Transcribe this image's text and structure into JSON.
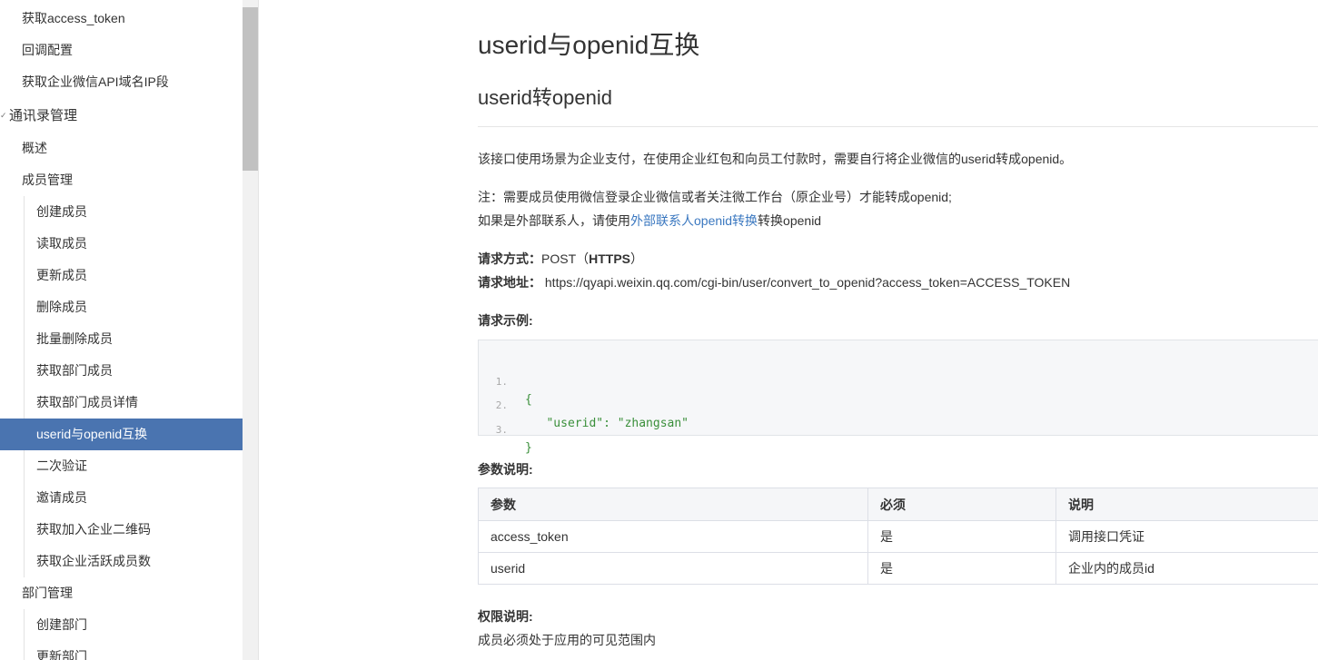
{
  "sidebar": {
    "items": [
      {
        "label": "获取access_token",
        "level": 1
      },
      {
        "label": "回调配置",
        "level": 1
      },
      {
        "label": "获取企业微信API域名IP段",
        "level": 1
      },
      {
        "label": "通讯录管理",
        "level": 0,
        "expanded": true
      },
      {
        "label": "概述",
        "level": 1
      },
      {
        "label": "成员管理",
        "level": 1
      },
      {
        "label": "创建成员",
        "level": 2
      },
      {
        "label": "读取成员",
        "level": 2
      },
      {
        "label": "更新成员",
        "level": 2
      },
      {
        "label": "删除成员",
        "level": 2
      },
      {
        "label": "批量删除成员",
        "level": 2
      },
      {
        "label": "获取部门成员",
        "level": 2
      },
      {
        "label": "获取部门成员详情",
        "level": 2
      },
      {
        "label": "userid与openid互换",
        "level": 2,
        "active": true
      },
      {
        "label": "二次验证",
        "level": 2
      },
      {
        "label": "邀请成员",
        "level": 2
      },
      {
        "label": "获取加入企业二维码",
        "level": 2
      },
      {
        "label": "获取企业活跃成员数",
        "level": 2
      },
      {
        "label": "部门管理",
        "level": 1
      },
      {
        "label": "创建部门",
        "level": 2
      },
      {
        "label": "更新部门",
        "level": 2
      }
    ],
    "expanded_caret": "✓"
  },
  "content": {
    "title": "userid与openid互换",
    "subtitle": "userid转openid",
    "desc": "该接口使用场景为企业支付，在使用企业红包和向员工付款时，需要自行将企业微信的userid转成openid。",
    "note_line1": "注：需要成员使用微信登录企业微信或者关注微工作台（原企业号）才能转成openid;",
    "note_line2_prefix": "如果是外部联系人，请使用",
    "note_link": "外部联系人openid转换",
    "note_line2_suffix": "转换openid",
    "method_label": "请求方式：",
    "method_value": "POST（",
    "method_proto": "HTTPS",
    "method_close": "）",
    "url_label": "请求地址：",
    "url_value": "https://qyapi.weixin.qq.com/cgi-bin/user/convert_to_openid?access_token=ACCESS_TOKEN",
    "example_label": "请求示例:",
    "code_lines": [
      {
        "num": "1.",
        "text": "{"
      },
      {
        "num": "2.",
        "text": "   \"userid\": \"zhangsan\""
      },
      {
        "num": "3.",
        "text": "}"
      }
    ],
    "params_label": "参数说明:",
    "table": {
      "headers": [
        "参数",
        "必须",
        "说明"
      ],
      "rows": [
        [
          "access_token",
          "是",
          "调用接口凭证"
        ],
        [
          "userid",
          "是",
          "企业内的成员id"
        ]
      ]
    },
    "perm_label": "权限说明:",
    "perm_text": "成员必须处于应用的可见范围内"
  },
  "colors": {
    "active_bg": "#4a74b0",
    "link": "#3b78c0",
    "code_text": "#2e8b2e"
  }
}
